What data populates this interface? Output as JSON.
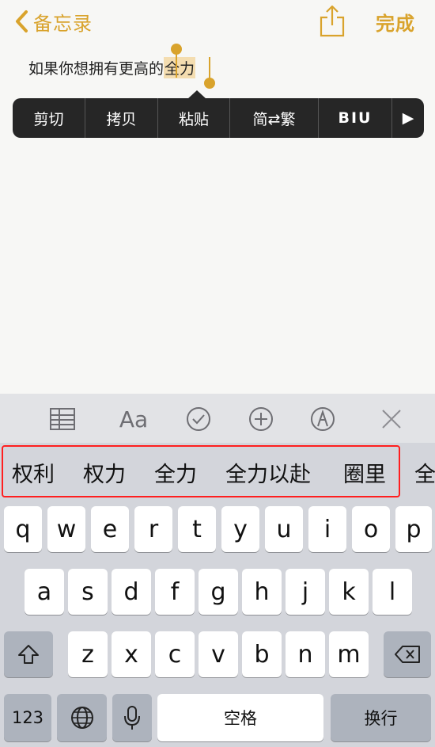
{
  "nav": {
    "back_label": "备忘录",
    "done_label": "完成"
  },
  "note": {
    "text_before": "如果你想拥有更高的",
    "selected_text": "全力"
  },
  "edit_menu": [
    {
      "label": "剪切"
    },
    {
      "label": "拷贝"
    },
    {
      "label": "粘贴"
    },
    {
      "label": "简⇄繁"
    },
    {
      "label": "BIU"
    },
    {
      "label": "▶"
    }
  ],
  "toolbar_icons": [
    "table-icon",
    "text-format-icon",
    "checklist-icon",
    "add-icon",
    "markup-pen-icon",
    "close-icon"
  ],
  "toolbar_format_label": "Aa",
  "candidates": [
    "权利",
    "权力",
    "全力",
    "全力以赴",
    "圈里",
    "全"
  ],
  "keyboard": {
    "row1": [
      "q",
      "w",
      "e",
      "r",
      "t",
      "y",
      "u",
      "i",
      "o",
      "p"
    ],
    "row2": [
      "a",
      "s",
      "d",
      "f",
      "g",
      "h",
      "j",
      "k",
      "l"
    ],
    "row3": [
      "z",
      "x",
      "c",
      "v",
      "b",
      "n",
      "m"
    ],
    "numbers_label": "123",
    "space_label": "空格",
    "return_label": "换行"
  },
  "colors": {
    "accent": "#d9a32c",
    "highlight_box": "#ff1f1f"
  }
}
